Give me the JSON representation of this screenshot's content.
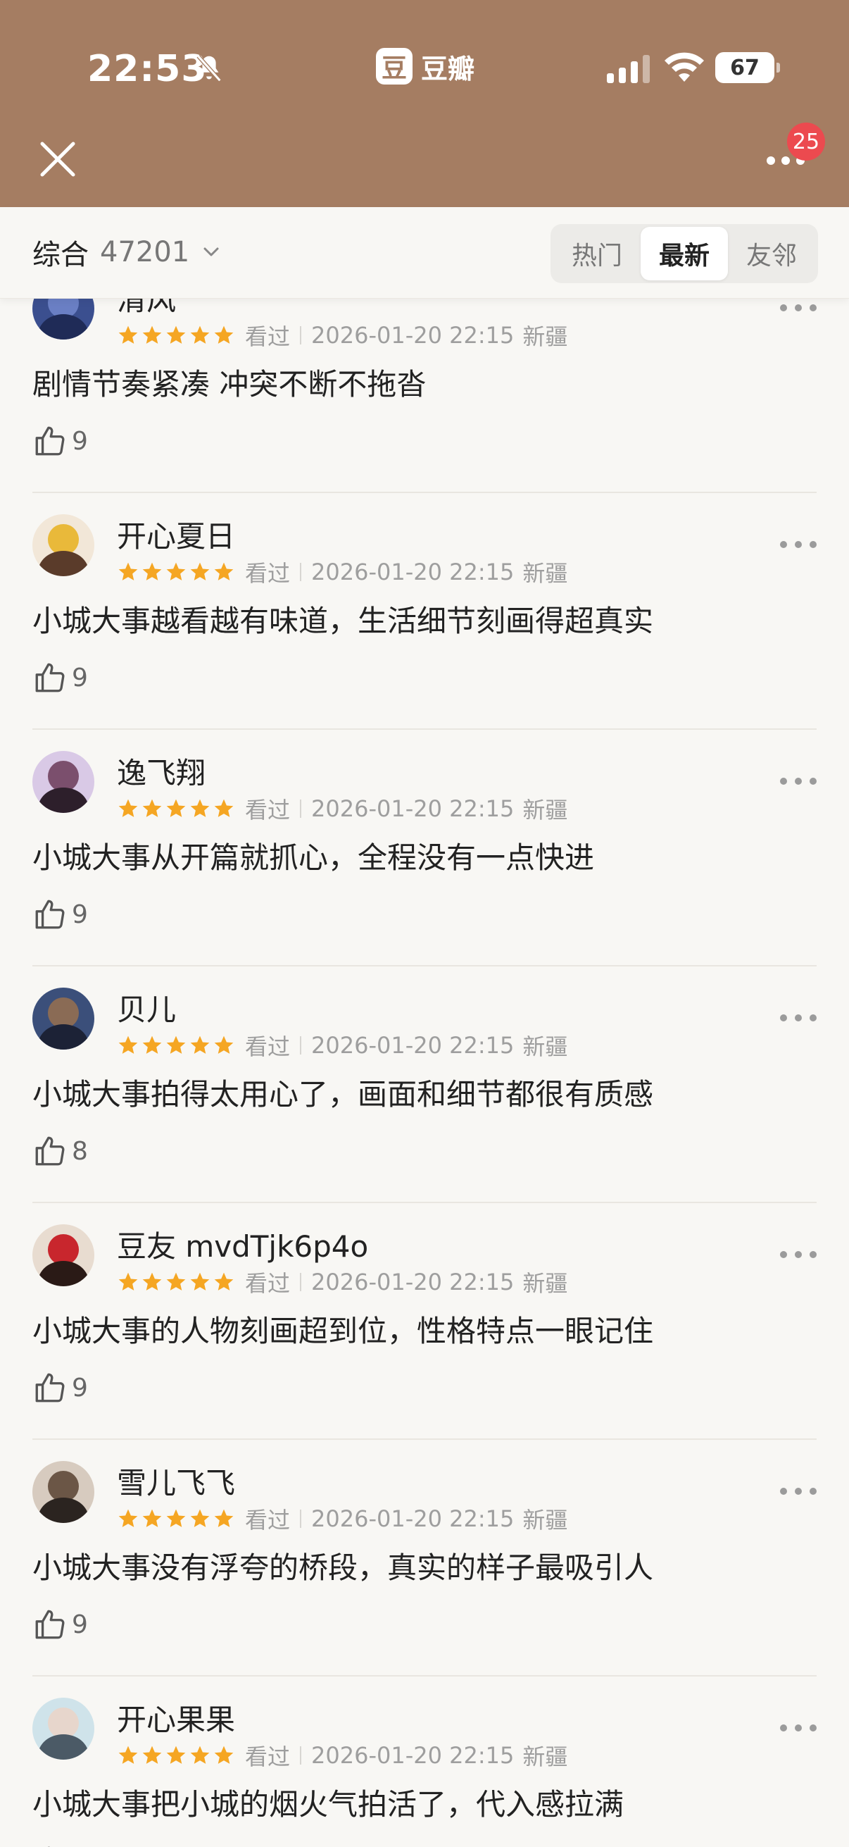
{
  "status_bar": {
    "time": "22:53",
    "app_name": "豆瓣",
    "app_logo_char": "豆",
    "battery": "67"
  },
  "nav": {
    "notification_count": "25"
  },
  "filter": {
    "sort_label": "综合",
    "total_count": "47201",
    "tabs": [
      "热门",
      "最新",
      "友邻"
    ],
    "active_tab": "最新"
  },
  "reviews": [
    {
      "user": "清风",
      "rating": 5,
      "status": "看过",
      "date": "2026-01-20 22:15",
      "location": "新疆",
      "content": "剧情节奏紧凑 冲突不断不拖沓",
      "likes": "9"
    },
    {
      "user": "开心夏日",
      "rating": 5,
      "status": "看过",
      "date": "2026-01-20 22:15",
      "location": "新疆",
      "content": "小城大事越看越有味道，生活细节刻画得超真实",
      "likes": "9"
    },
    {
      "user": "逸飞翔",
      "rating": 5,
      "status": "看过",
      "date": "2026-01-20 22:15",
      "location": "新疆",
      "content": "小城大事从开篇就抓心，全程没有一点快进",
      "likes": "9"
    },
    {
      "user": "贝儿",
      "rating": 5,
      "status": "看过",
      "date": "2026-01-20 22:15",
      "location": "新疆",
      "content": "小城大事拍得太用心了，画面和细节都很有质感",
      "likes": "8"
    },
    {
      "user": "豆友 mvdTjk6p4o",
      "rating": 5,
      "status": "看过",
      "date": "2026-01-20 22:15",
      "location": "新疆",
      "content": "小城大事的人物刻画超到位，性格特点一眼记住",
      "likes": "9"
    },
    {
      "user": "雪儿飞飞",
      "rating": 5,
      "status": "看过",
      "date": "2026-01-20 22:15",
      "location": "新疆",
      "content": "小城大事没有浮夸的桥段，真实的样子最吸引人",
      "likes": "9"
    },
    {
      "user": "开心果果",
      "rating": 5,
      "status": "看过",
      "date": "2026-01-20 22:15",
      "location": "新疆",
      "content": "小城大事把小城的烟火气拍活了，代入感拉满",
      "likes": ""
    }
  ],
  "colors": {
    "header_bg": "#a57d62",
    "star": "#f5a623",
    "badge": "#ec4a4f"
  }
}
